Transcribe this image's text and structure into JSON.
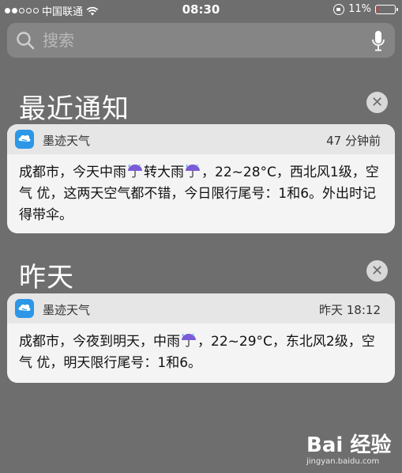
{
  "status_bar": {
    "carrier": "中国联通",
    "time": "08:30",
    "battery_percent": "11%",
    "battery_level": 0.11,
    "signal_bars_filled": 2,
    "signal_bars_total": 5
  },
  "search": {
    "placeholder": "搜索"
  },
  "sections": [
    {
      "title": "最近通知",
      "notification": {
        "app_name": "墨迹天气",
        "time": "47 分钟前",
        "body_parts": [
          "成都市，今天中雨",
          "转大雨",
          "，22~28°C，西北风1级，空气 优，这两天空气都不错，今日限行尾号：1和6。外出时记得带伞。"
        ]
      }
    },
    {
      "title": "昨天",
      "notification": {
        "app_name": "墨迹天气",
        "time": "昨天 18:12",
        "body_parts": [
          "成都市，今夜到明天，中雨",
          "，22~29°C，东北风2级，空气 优，明天限行尾号：1和6。"
        ]
      }
    }
  ],
  "watermark": {
    "brand": "Bai 经验",
    "url": "jingyan.baidu.com"
  },
  "colors": {
    "background": "#6e6e6e",
    "app_icon": "#2b97e6",
    "battery_low": "#ff2d2d"
  }
}
